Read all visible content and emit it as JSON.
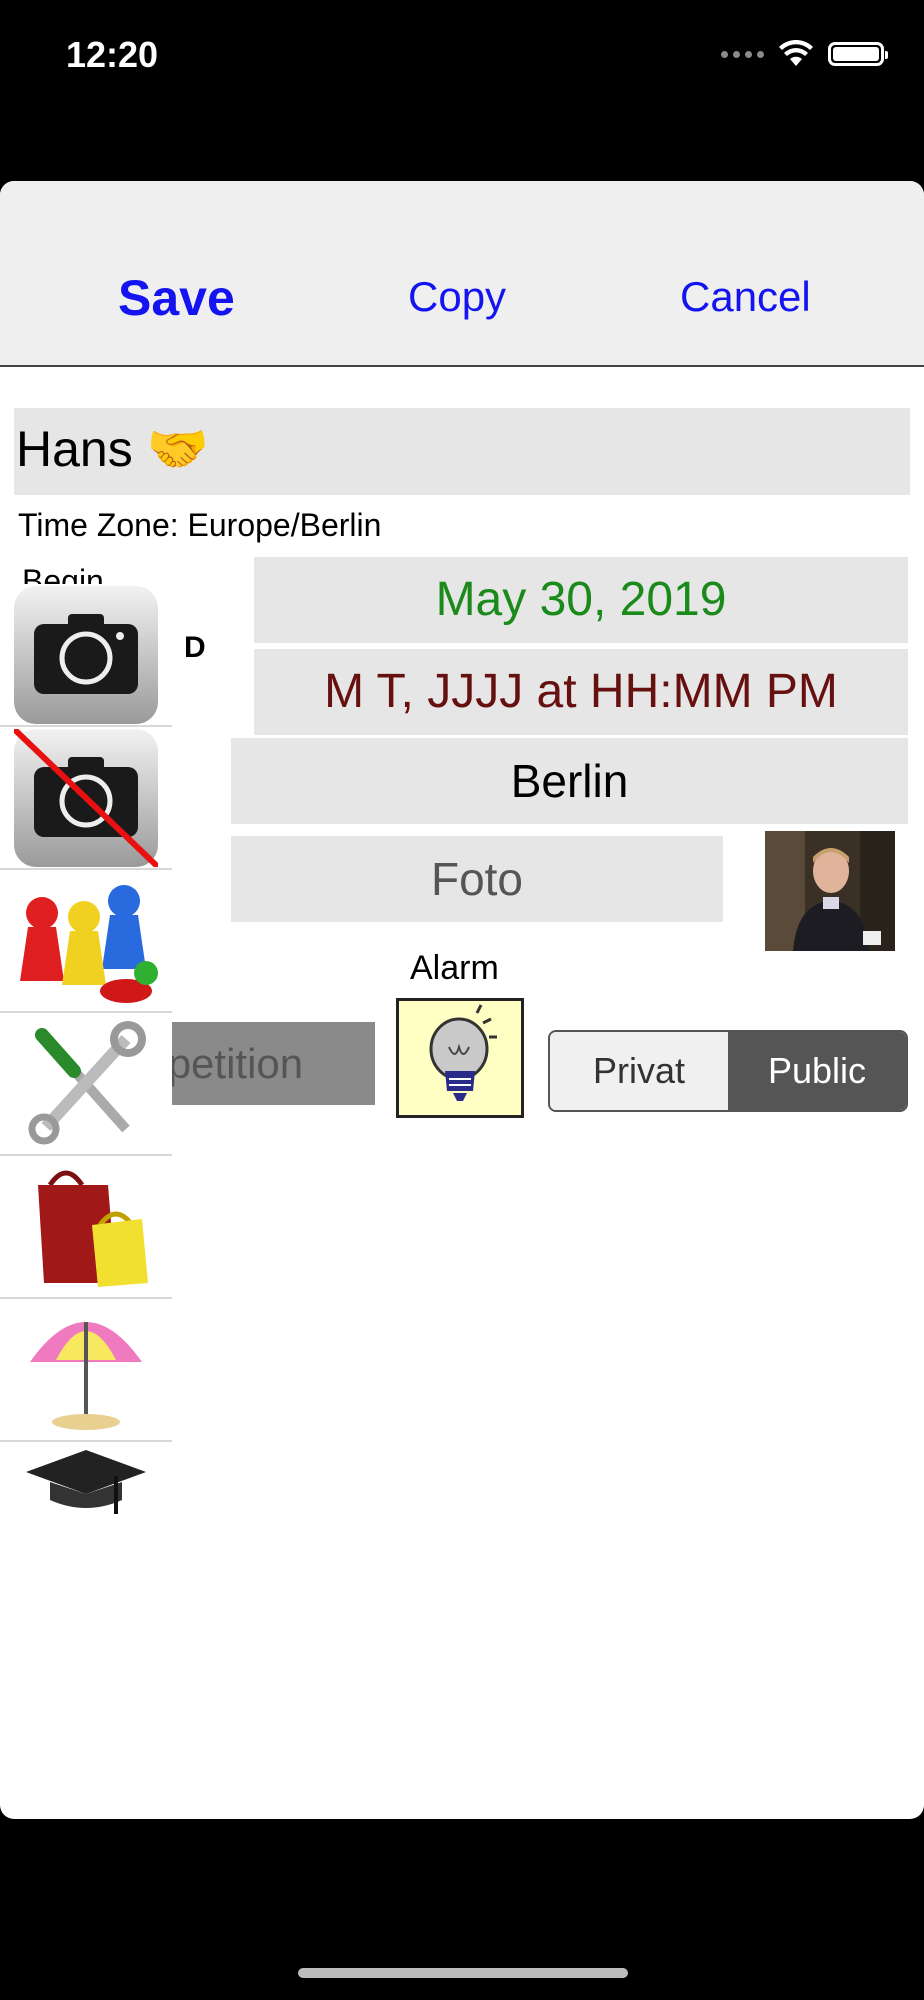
{
  "status_bar": {
    "time": "12:20"
  },
  "nav": {
    "save_label": "Save",
    "copy_label": "Copy",
    "cancel_label": "Cancel"
  },
  "form": {
    "name": "Hans 🤝",
    "time_zone": "Time Zone: Europe/Berlin",
    "begin_label": "Begin",
    "d_label": "D",
    "date": "May 30, 2019",
    "time_format": "M T, JJJJ at HH:MM PM",
    "city": "Berlin",
    "foto_label": "Foto",
    "alarm_label": "Alarm",
    "repetition_label": "Repetition",
    "visibility": {
      "options": [
        "Privat",
        "Public"
      ],
      "selected": "Public"
    }
  },
  "icons": [
    "camera-icon",
    "no-camera-icon",
    "game-pieces-icon",
    "tools-icon",
    "shopping-bags-icon",
    "beach-umbrella-icon",
    "graduation-cap-icon"
  ],
  "colors": {
    "nav_button": "#1414f0",
    "date_text": "#1a8a1a",
    "time_text": "#661010",
    "field_bg": "#e6e6e6"
  }
}
